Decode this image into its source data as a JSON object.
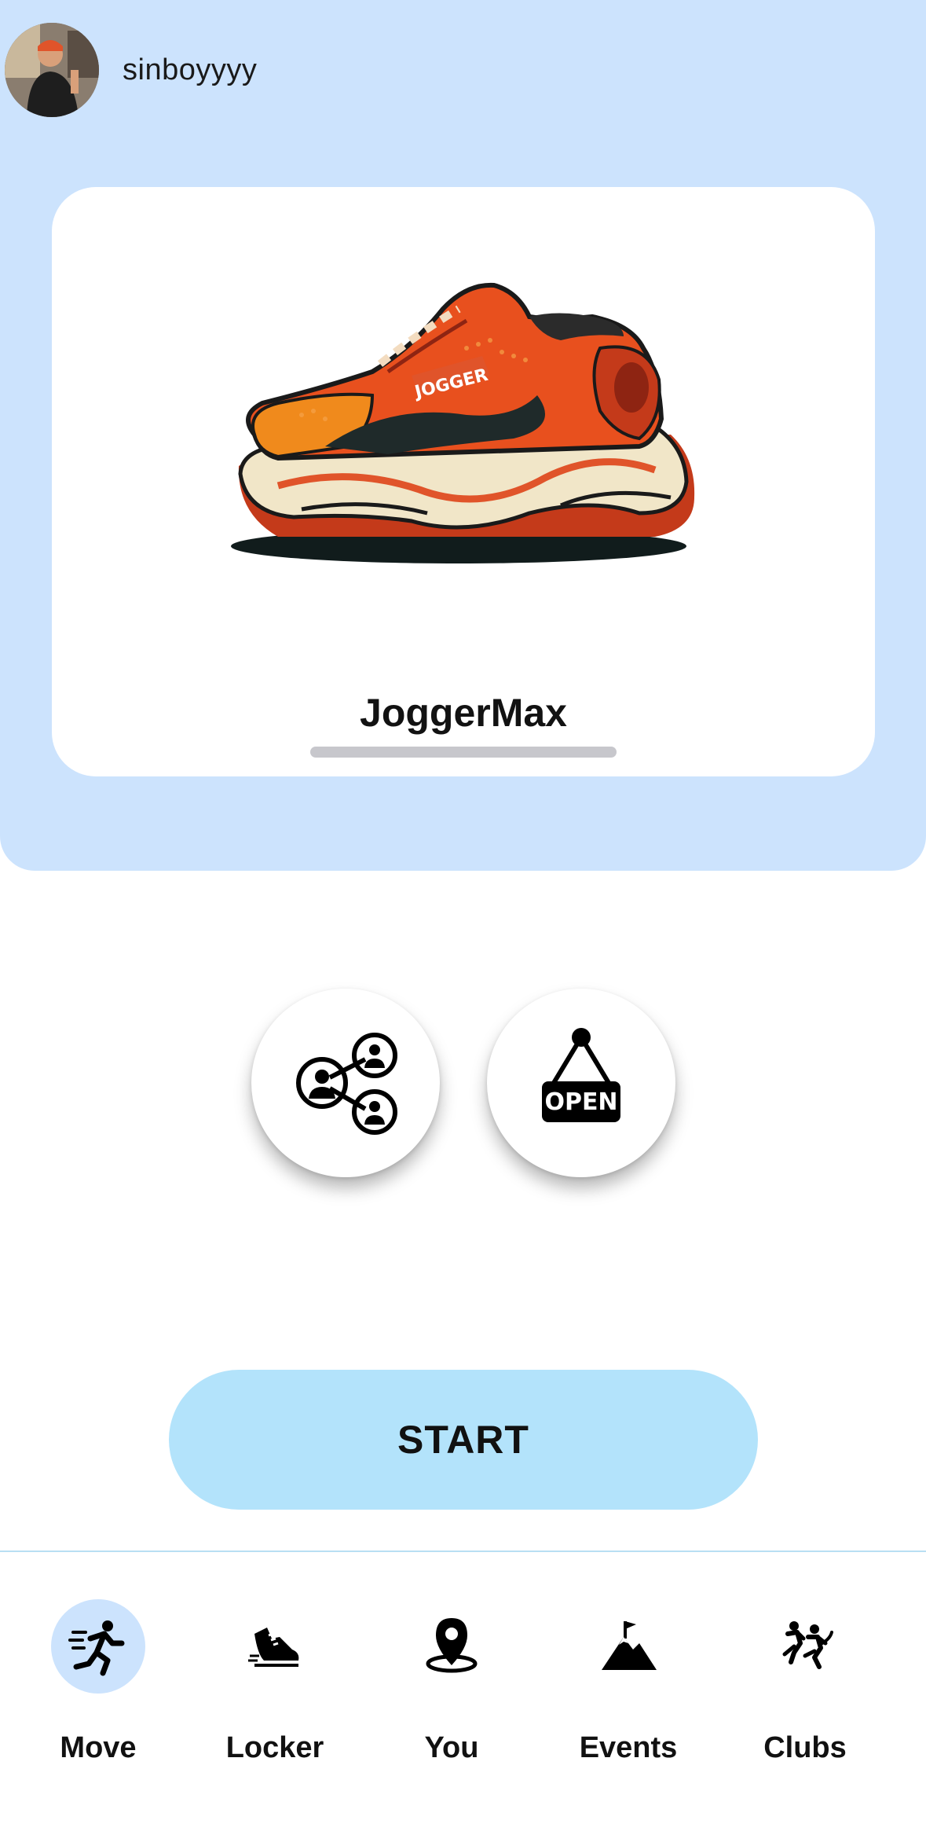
{
  "header": {
    "username": "sinboyyyy"
  },
  "card": {
    "shoe_name": "JoggerMax",
    "shoe_logo_text": "JOGGER"
  },
  "actions": {
    "open_sign_text": "OPEN",
    "start_label": "START"
  },
  "tabs": [
    {
      "label": "Move",
      "icon": "runner-icon",
      "active": true
    },
    {
      "label": "Locker",
      "icon": "sneaker-icon",
      "active": false
    },
    {
      "label": "You",
      "icon": "location-pin-icon",
      "active": false
    },
    {
      "label": "Events",
      "icon": "mountain-flag-icon",
      "active": false
    },
    {
      "label": "Clubs",
      "icon": "group-runners-icon",
      "active": false
    }
  ],
  "colors": {
    "hero_bg": "#cce3fd",
    "start_button": "#b3e3fb",
    "active_tab": "#cce3fd",
    "shoe_primary": "#e8501e",
    "shoe_secondary": "#f08a1c"
  }
}
